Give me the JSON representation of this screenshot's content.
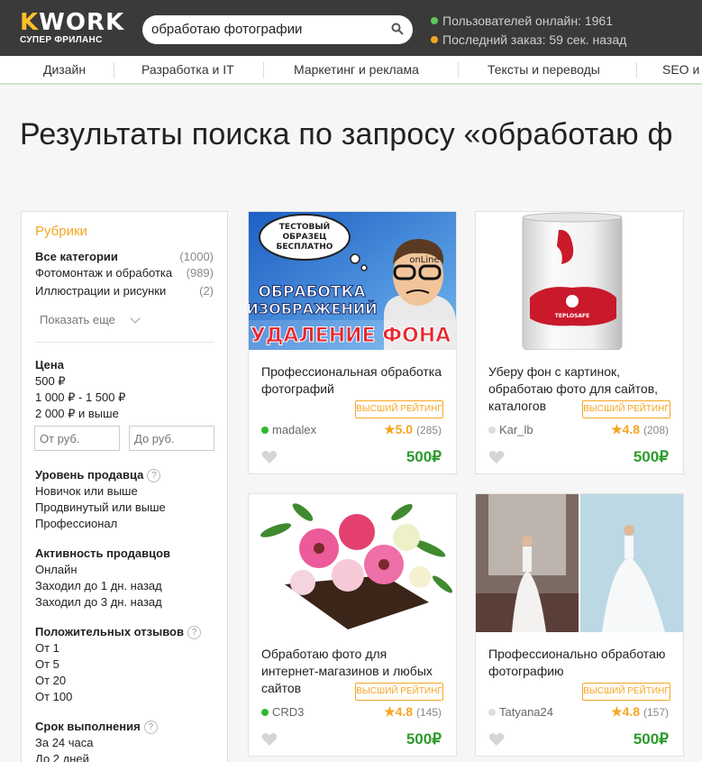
{
  "header": {
    "logo": "KWORK",
    "logo_sub": "СУПЕР ФРИЛАНС",
    "search_value": "обработаю фотографии",
    "users_online": "Пользователей онлайн: 1961",
    "last_order": "Последний заказ: 59 сек. назад",
    "dot_colors": {
      "online": "#5cc85c",
      "order": "#f5a623"
    }
  },
  "nav": [
    "Дизайн",
    "Разработка и IT",
    "Маркетинг и реклама",
    "Тексты и переводы",
    "SEO и т"
  ],
  "page_title": "Результаты поиска по запросу «обработаю ф",
  "sidebar": {
    "rubrics_title": "Рубрики",
    "categories": [
      {
        "label": "Все категории",
        "count": "(1000)"
      },
      {
        "label": "Фотомонтаж и обработка",
        "count": "(989)"
      },
      {
        "label": "Иллюстрации и рисунки",
        "count": "(2)"
      }
    ],
    "show_more": "Показать еще",
    "price_title": "Цена",
    "price_options": [
      "500 ₽",
      "1 000 ₽ - 1 500 ₽",
      "2 000 ₽ и выше"
    ],
    "price_from_placeholder": "От руб.",
    "price_to_placeholder": "До руб.",
    "level_title": "Уровень продавца",
    "level_options": [
      "Новичок или выше",
      "Продвинутый или выше",
      "Профессионал"
    ],
    "activity_title": "Активность продавцов",
    "activity_options": [
      "Онлайн",
      "Заходил до 1 дн. назад",
      "Заходил до 3 дн. назад"
    ],
    "reviews_title": "Положительных отзывов",
    "reviews_options": [
      "От 1",
      "От 5",
      "От 20",
      "От 100"
    ],
    "term_title": "Срок выполнения",
    "term_options": [
      "За 24 часа",
      "До 2 дней"
    ],
    "help_icon": "?"
  },
  "cards": [
    {
      "title": "Профессиональная обработка фотографий",
      "badge": "ВЫСШИЙ РЕЙТИНГ",
      "user": "madalex",
      "online": true,
      "rating": "5.0",
      "reviews": "(285)",
      "price": "500₽",
      "image_text": [
        "ТЕСТОВЫЙ",
        "ОБРАЗЕЦ",
        "БЕСПЛАТНО",
        "ОБРАБОТКА",
        "ИЗОБРАЖЕНИЙ",
        "УДАЛЕНИЕ ФОНА",
        "onLine"
      ]
    },
    {
      "title": "Уберу фон с картинок, обработаю фото для сайтов, каталогов",
      "badge": "ВЫСШИЙ РЕЙТИНГ",
      "user": "Kar_lb",
      "online": false,
      "rating": "4.8",
      "reviews": "(208)",
      "price": "500₽",
      "image_text": [
        "TEPLOSAFE"
      ]
    },
    {
      "title": "Обработаю фото для интернет-магазинов и любых сайтов",
      "badge": "ВЫСШИЙ РЕЙТИНГ",
      "user": "CRD3",
      "online": true,
      "rating": "4.8",
      "reviews": "(145)",
      "price": "500₽"
    },
    {
      "title": "Профессионально обработаю фотографию",
      "badge": "ВЫСШИЙ РЕЙТИНГ",
      "user": "Tatyana24",
      "online": false,
      "rating": "4.8",
      "reviews": "(157)",
      "price": "500₽"
    }
  ],
  "colors": {
    "accent": "#f5a623",
    "price": "#2d9b2d",
    "online": "#2fb82f",
    "offline": "#dddddd"
  }
}
